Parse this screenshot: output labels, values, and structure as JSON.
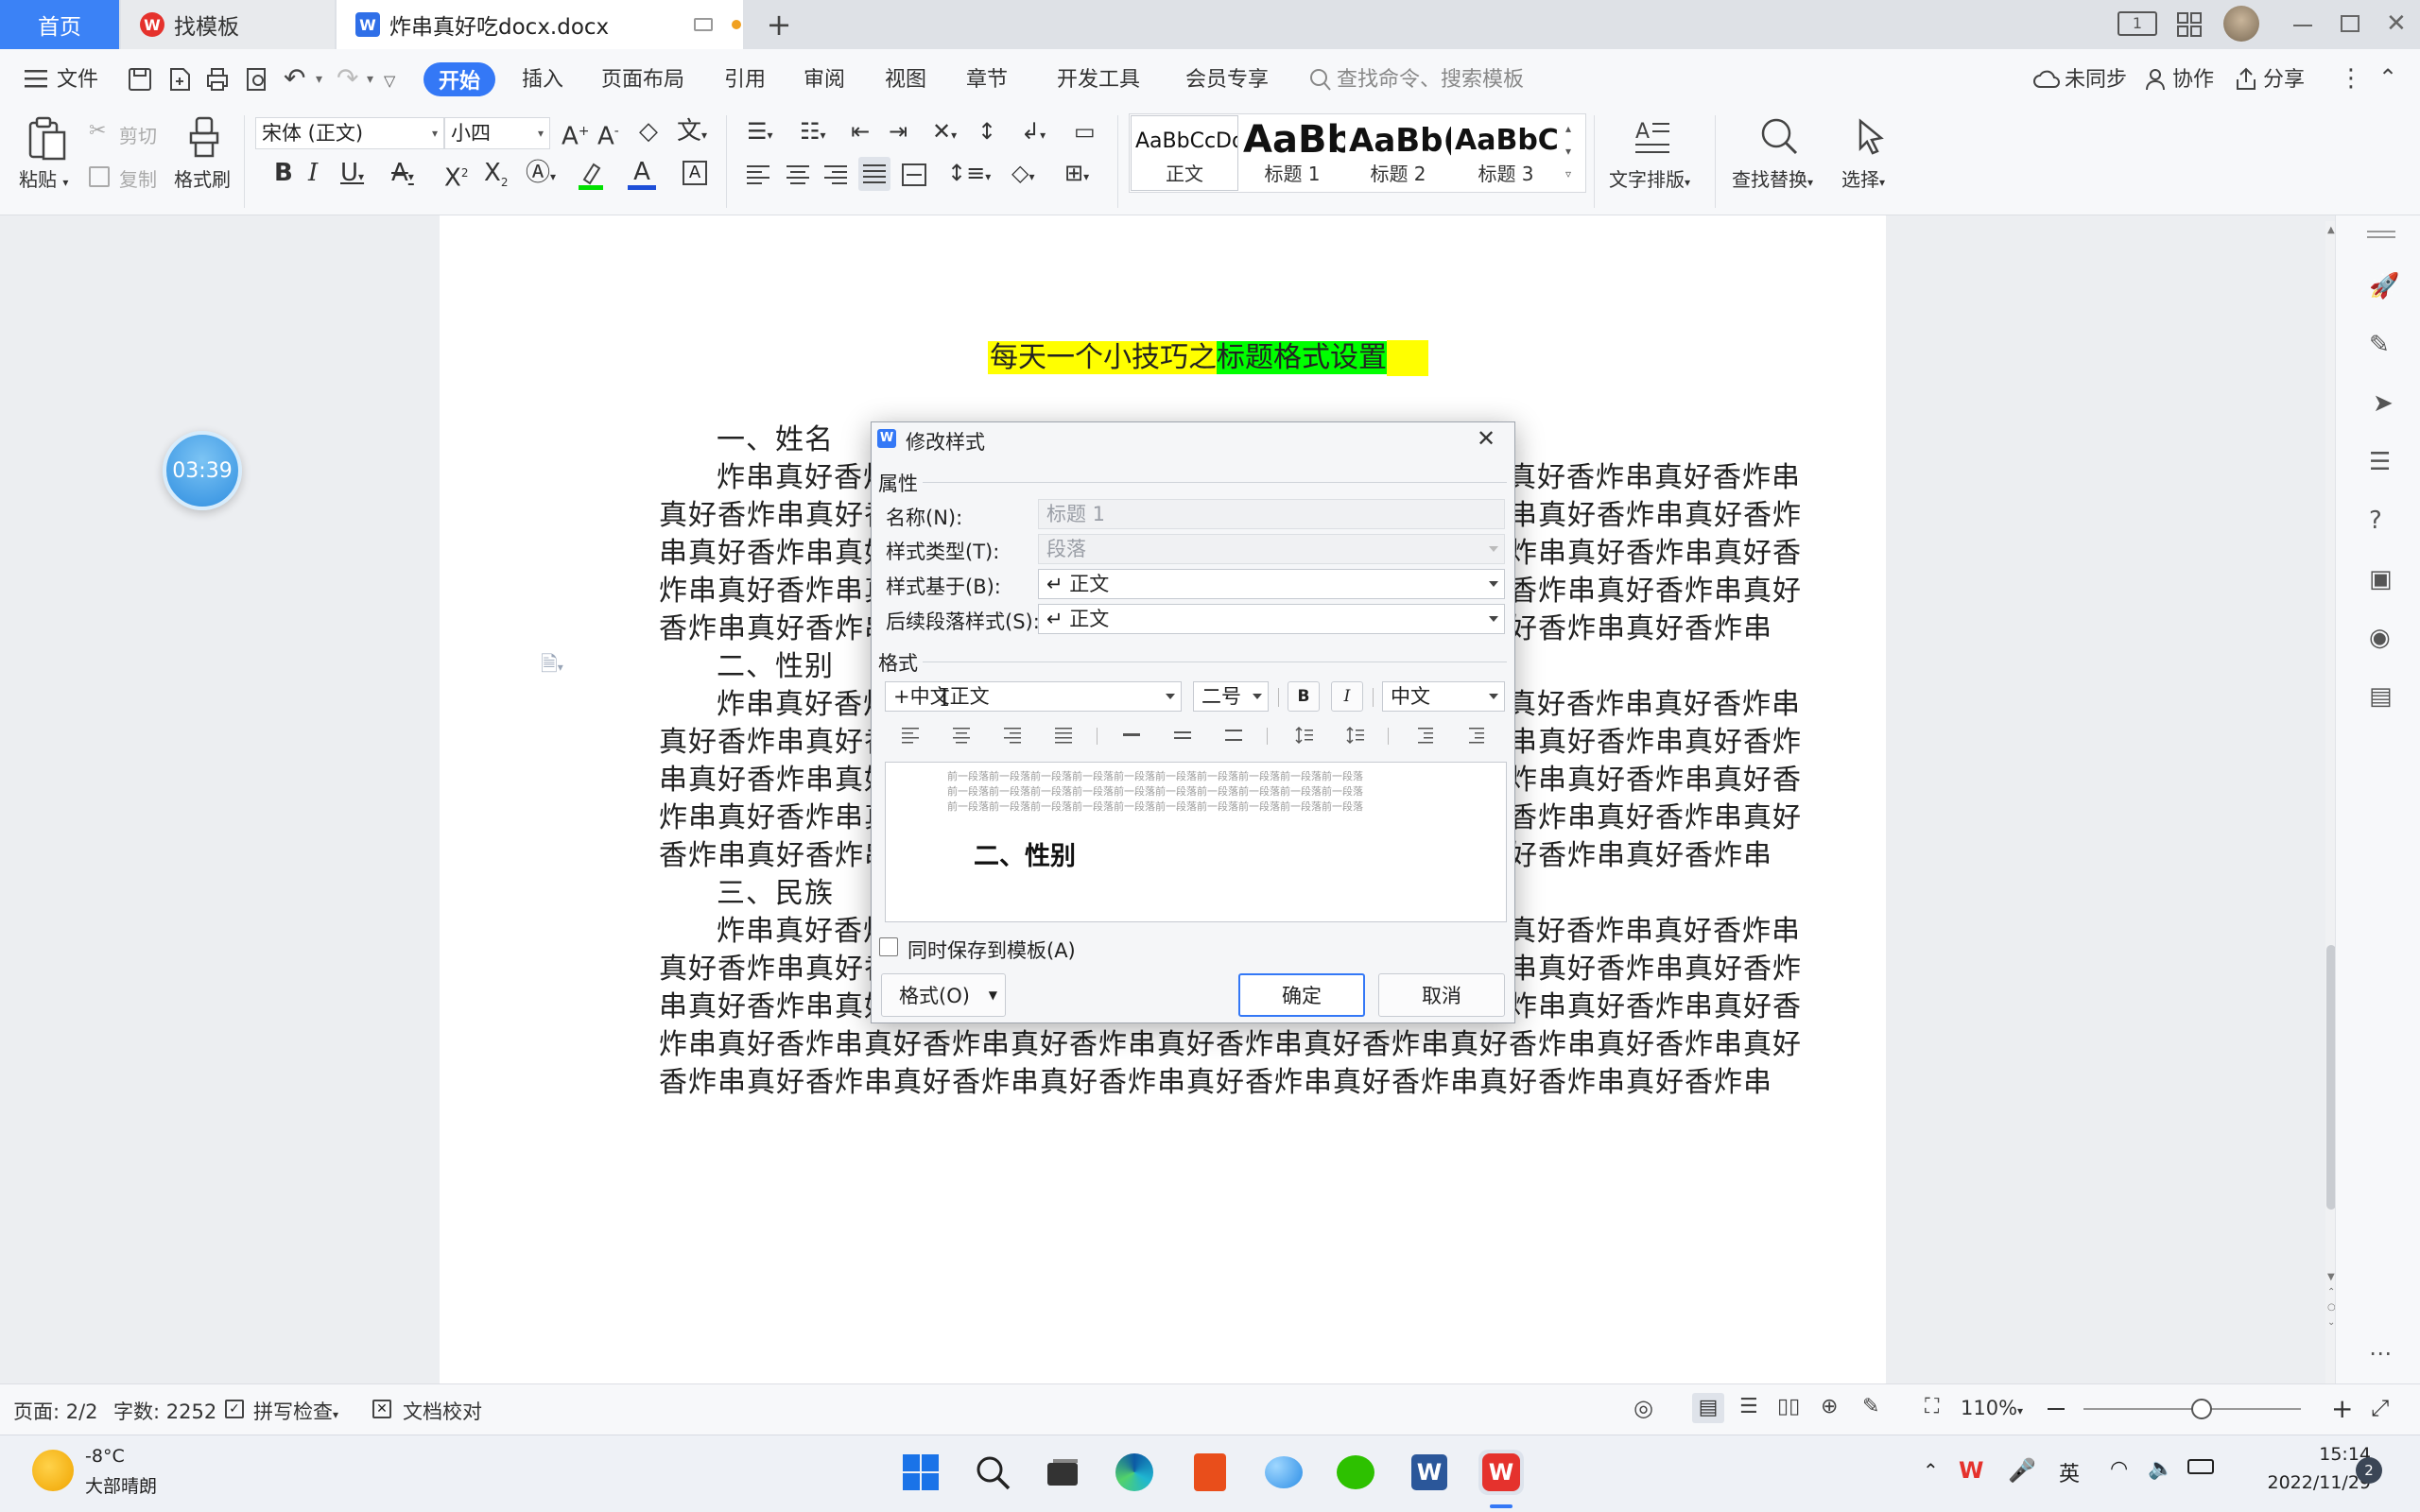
{
  "tabs": {
    "home": "首页",
    "template": "找模板",
    "document": "炸串真好吃docx.docx",
    "new_tab": "+"
  },
  "menu": {
    "file": "文件",
    "start": "开始",
    "insert": "插入",
    "layout": "页面布局",
    "reference": "引用",
    "review": "审阅",
    "view": "视图",
    "chapter": "章节",
    "devtools": "开发工具",
    "member": "会员专享",
    "search_placeholder": "查找命令、搜索模板",
    "unsynced": "未同步",
    "collab": "协作",
    "share": "分享"
  },
  "ribbon": {
    "paste": "粘贴",
    "cut": "剪切",
    "copy": "复制",
    "format_painter": "格式刷",
    "font_name": "宋体 (正文)",
    "font_size": "小四",
    "styles": [
      {
        "preview": "AaBbCcDd",
        "label": "正文"
      },
      {
        "preview": "AaBb",
        "label": "标题 1"
      },
      {
        "preview": "AaBb(",
        "label": "标题 2"
      },
      {
        "preview": "AaBbC",
        "label": "标题 3"
      }
    ],
    "text_layout": "文字排版",
    "find_replace": "查找替换",
    "select": "选择"
  },
  "document": {
    "title_part1": "每天一个小技巧之",
    "title_part2": "标题格式设置",
    "lines": [
      "一、姓名",
      "炸串真好香炸串真好香炸串真好香炸串真好香炸串真好香炸串真好香炸串真好香炸串",
      "真好香炸串真好香炸串真好香炸串真好香炸串真好香炸串真好香炸串真好香炸串真好香炸",
      "串真好香炸串真好香炸串真好香炸串真好香炸串真好香炸串真好香炸串真好香炸串真好香",
      "炸串真好香炸串真好香炸串真好香炸串真好香炸串真好香炸串真好香炸串真好香炸串真好",
      "香炸串真好香炸串真好香炸串真好香炸串真好香炸串真好香炸串真好香炸串真好香炸串",
      "二、性别",
      "炸串真好香炸串真好香炸串真好香炸串真好香炸串真好香炸串真好香炸串真好香炸串",
      "真好香炸串真好香炸串真好香炸串真好香炸串真好香炸串真好香炸串真好香炸串真好香炸",
      "串真好香炸串真好香炸串真好香炸串真好香炸串真好香炸串真好香炸串真好香炸串真好香",
      "炸串真好香炸串真好香炸串真好香炸串真好香炸串真好香炸串真好香炸串真好香炸串真好",
      "香炸串真好香炸串真好香炸串真好香炸串真好香炸串真好香炸串真好香炸串真好香炸串",
      "三、民族",
      "炸串真好香炸串真好香炸串真好香炸串真好香炸串真好香炸串真好香炸串真好香炸串",
      "真好香炸串真好香炸串真好香炸串真好香炸串真好香炸串真好香炸串真好香炸串真好香炸",
      "串真好香炸串真好香炸串真好香炸串真好香炸串真好香炸串真好香炸串真好香炸串真好香",
      "炸串真好香炸串真好香炸串真好香炸串真好香炸串真好香炸串真好香炸串真好香炸串真好",
      "香炸串真好香炸串真好香炸串真好香炸串真好香炸串真好香炸串真好香炸串真好香炸串"
    ]
  },
  "timer": "03:39",
  "dialog": {
    "title": "修改样式",
    "section_properties": "属性",
    "name_label": "名称(N):",
    "name_value": "标题 1",
    "type_label": "样式类型(T):",
    "type_value": "段落",
    "based_label": "样式基于(B):",
    "based_value": "↵ 正文",
    "next_label": "后续段落样式(S):",
    "next_value": "↵ 正文",
    "section_format": "格式",
    "font_value": "+中文正文",
    "size_value": "二号",
    "bold": "B",
    "italic": "I",
    "script_value": "中文",
    "preview_prev_line": "前一段落前一段落前一段落前一段落前一段落前一段落前一段落前一段落前一段落前一段落",
    "preview_heading": "二、性别",
    "save_template_label": "同时保存到模板(A)",
    "format_button": "格式(O)",
    "ok": "确定",
    "cancel": "取消"
  },
  "status": {
    "page": "页面: 2/2",
    "word_count": "字数: 2252",
    "spellcheck": "拼写检查",
    "proofread": "文档校对",
    "zoom": "110%"
  },
  "taskbar": {
    "temperature": "-8°C",
    "weather": "大部晴朗",
    "ime": "英",
    "time": "15:14",
    "date": "2022/11/29",
    "notifications": "2"
  },
  "colors": {
    "accent_blue": "#3478f6",
    "highlight_yellow": "#ffff00",
    "highlight_green": "#00ff00",
    "wps_red": "#e5322d"
  }
}
